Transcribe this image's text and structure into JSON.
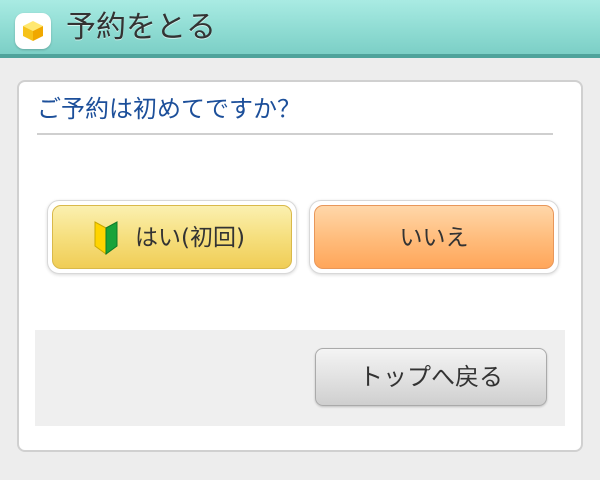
{
  "header": {
    "title": "予約をとる",
    "icon": "cube-icon"
  },
  "question": {
    "text": "ご予約は初めてですか？"
  },
  "buttons": {
    "yes_label": "はい(初回)",
    "yes_icon": "beginner-mark-icon",
    "no_label": "いいえ",
    "back_label": "トップへ戻る"
  },
  "colors": {
    "header_bg": "#8fdcd3",
    "header_border": "#4fa39b",
    "question_text": "#1c4f9a",
    "yes_button": "#f6df7e",
    "no_button": "#ffbb7a",
    "back_button": "#e2e2e2"
  }
}
